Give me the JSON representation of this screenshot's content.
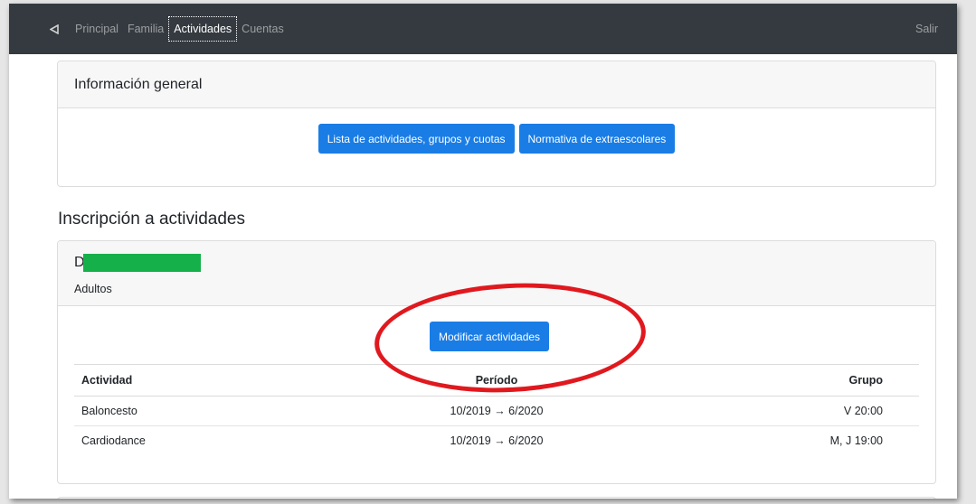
{
  "navbar": {
    "back_icon": "back-triangle-icon",
    "links": [
      {
        "label": "Principal",
        "active": false
      },
      {
        "label": "Familia",
        "active": false
      },
      {
        "label": "Actividades",
        "active": true
      },
      {
        "label": "Cuentas",
        "active": false
      }
    ],
    "logout_label": "Salir"
  },
  "general_info": {
    "title": "Información general",
    "buttons": [
      {
        "label": "Lista de actividades, grupos y cuotas"
      },
      {
        "label": "Normativa de extraescolares"
      }
    ]
  },
  "enrollment": {
    "title": "Inscripción a actividades",
    "person": {
      "name_visible": "D",
      "group": "Adultos"
    },
    "modify_button": "Modificar actividades",
    "table": {
      "headers": [
        "Actividad",
        "Período",
        "Grupo"
      ],
      "rows": [
        [
          "Baloncesto",
          "10/2019 → 6/2020",
          "V 20:00"
        ],
        [
          "Cardiodance",
          "10/2019 → 6/2020",
          "M, J 19:00"
        ]
      ]
    }
  },
  "colors": {
    "navbar_bg": "#343a40",
    "primary_button": "#1a7de6",
    "redaction": "#16b04a",
    "annotation_red": "#e0191f"
  }
}
